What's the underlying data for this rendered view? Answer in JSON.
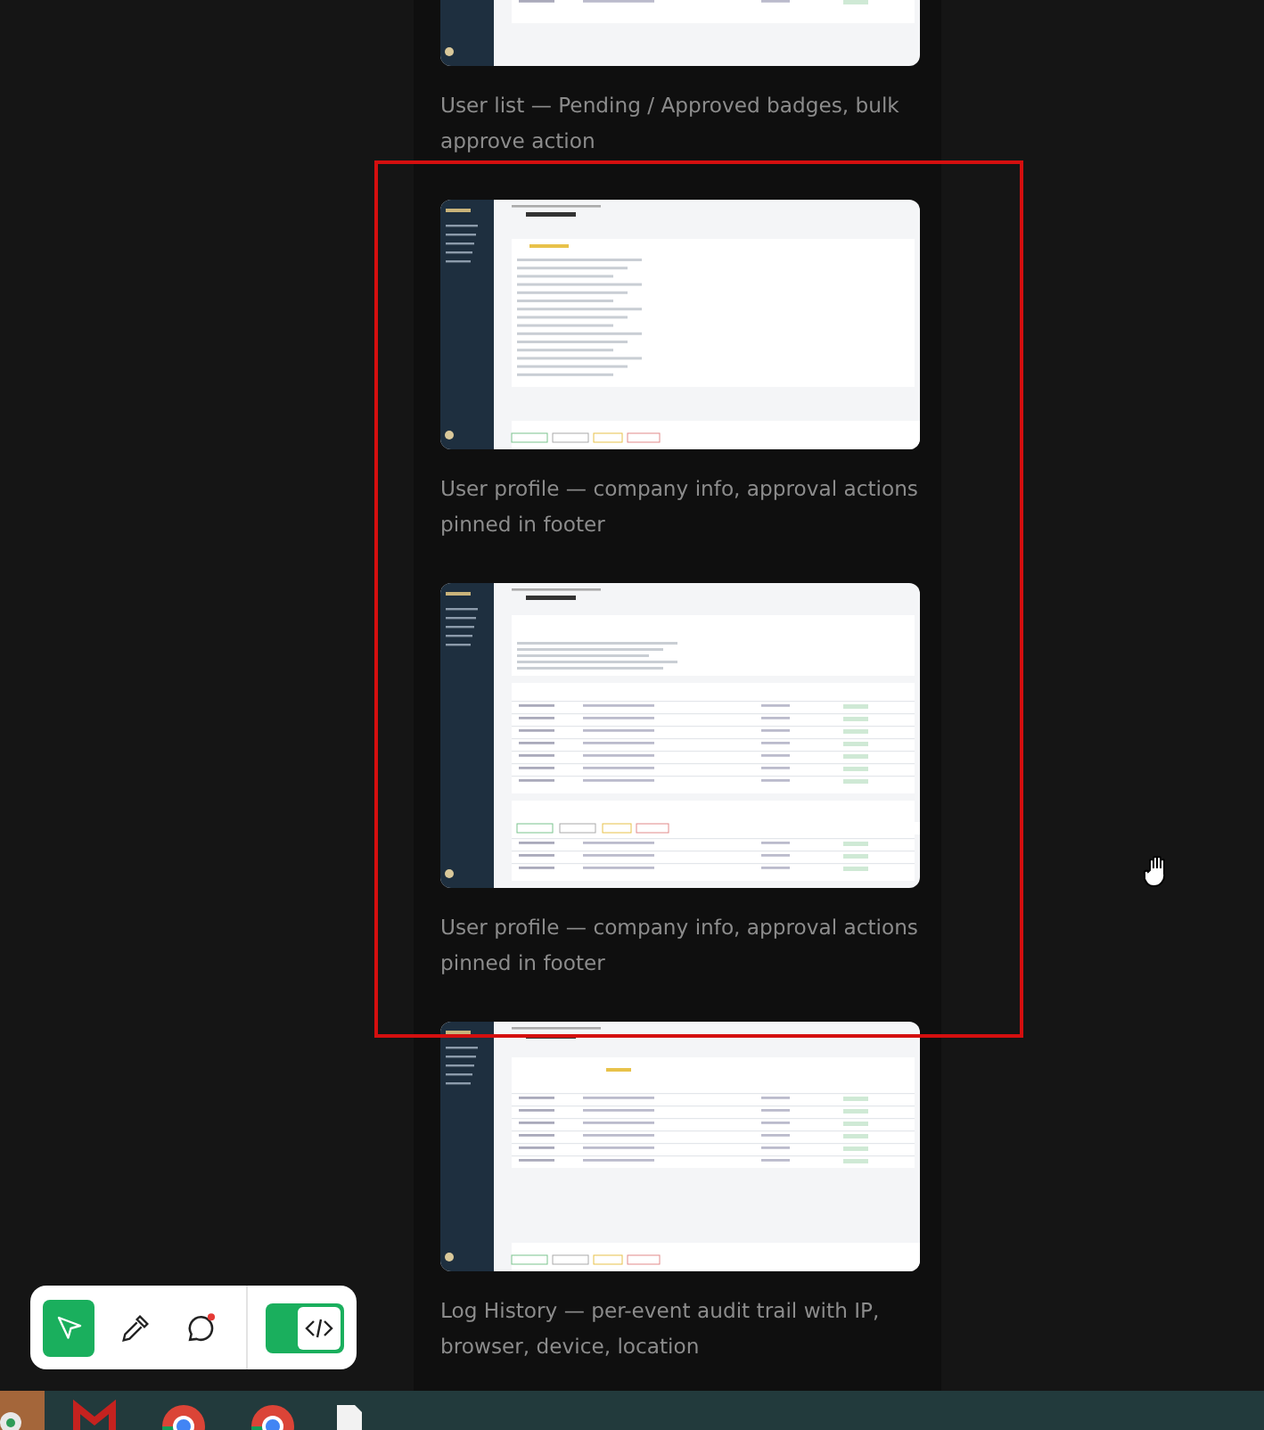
{
  "gallery": [
    {
      "kind": "list",
      "caption": "User list — Pending / Approved badges, bulk approve action"
    },
    {
      "kind": "profile",
      "caption": "User profile — company info, approval actions pinned in footer"
    },
    {
      "kind": "table",
      "caption": "User profile — company info, approval actions pinned in footer"
    },
    {
      "kind": "log",
      "caption": "Log History — per-event audit trail with IP, browser, device, location"
    }
  ],
  "toolbar": {
    "tools": [
      {
        "kind": "pointer",
        "selected": true
      },
      {
        "kind": "picker",
        "selected": false
      },
      {
        "kind": "comment",
        "selected": false
      }
    ],
    "code_toggle": {
      "on": true
    }
  }
}
